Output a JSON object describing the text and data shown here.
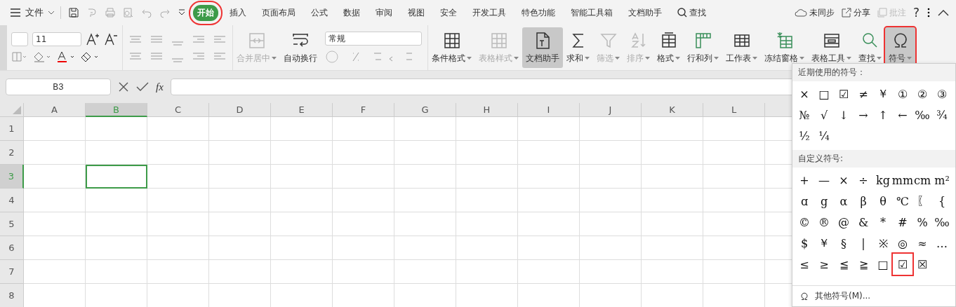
{
  "menu_bar": {
    "file_menu": "文件",
    "tabs": [
      {
        "label": "开始",
        "selected": true,
        "highlighted": true
      },
      {
        "label": "插入",
        "selected": false,
        "highlighted": false
      },
      {
        "label": "页面布局",
        "selected": false,
        "highlighted": false
      },
      {
        "label": "公式",
        "selected": false,
        "highlighted": false
      },
      {
        "label": "数据",
        "selected": false,
        "highlighted": false
      },
      {
        "label": "审阅",
        "selected": false,
        "highlighted": false
      },
      {
        "label": "视图",
        "selected": false,
        "highlighted": false
      },
      {
        "label": "安全",
        "selected": false,
        "highlighted": false
      },
      {
        "label": "开发工具",
        "selected": false,
        "highlighted": false
      },
      {
        "label": "特色功能",
        "selected": false,
        "highlighted": false
      },
      {
        "label": "智能工具箱",
        "selected": false,
        "highlighted": false
      },
      {
        "label": "文档助手",
        "selected": false,
        "highlighted": false
      }
    ],
    "search": "查找",
    "sync": "未同步",
    "share": "分享",
    "comment": {
      "label": "批注",
      "disabled": true
    },
    "help": "?"
  },
  "ribbon": {
    "font_size": "11",
    "number_format": "常规",
    "buttons": [
      {
        "kind": "merge",
        "label": "合并居中",
        "disabled": true,
        "selected": false,
        "caret": true,
        "highlighted": false
      },
      {
        "kind": "wrap",
        "label": "自动换行",
        "disabled": false,
        "selected": false,
        "caret": false,
        "highlighted": false
      },
      {
        "kind": "cond",
        "label": "条件格式",
        "disabled": false,
        "selected": false,
        "caret": true,
        "highlighted": false
      },
      {
        "kind": "style",
        "label": "表格样式",
        "disabled": true,
        "selected": false,
        "caret": true,
        "highlighted": false
      },
      {
        "kind": "doc",
        "label": "文档助手",
        "disabled": false,
        "selected": true,
        "caret": false,
        "highlighted": false
      },
      {
        "kind": "sum",
        "label": "求和",
        "disabled": false,
        "selected": false,
        "caret": true,
        "highlighted": false
      },
      {
        "kind": "filter",
        "label": "筛选",
        "disabled": true,
        "selected": false,
        "caret": true,
        "highlighted": false
      },
      {
        "kind": "sort",
        "label": "排序",
        "disabled": true,
        "selected": false,
        "caret": true,
        "highlighted": false
      },
      {
        "kind": "format",
        "label": "格式",
        "disabled": false,
        "selected": false,
        "caret": true,
        "highlighted": false
      },
      {
        "kind": "rowcol",
        "label": "行和列",
        "disabled": false,
        "selected": false,
        "caret": true,
        "highlighted": false
      },
      {
        "kind": "sheet",
        "label": "工作表",
        "disabled": false,
        "selected": false,
        "caret": true,
        "highlighted": false
      },
      {
        "kind": "freeze",
        "label": "冻结窗格",
        "disabled": false,
        "selected": false,
        "caret": true,
        "highlighted": false
      },
      {
        "kind": "tools",
        "label": "表格工具",
        "disabled": false,
        "selected": false,
        "caret": true,
        "highlighted": false
      },
      {
        "kind": "find",
        "label": "查找",
        "disabled": false,
        "selected": false,
        "caret": true,
        "highlighted": false
      },
      {
        "kind": "omega",
        "label": "符号",
        "disabled": false,
        "selected": true,
        "caret": true,
        "highlighted": true
      }
    ]
  },
  "formula_bar": {
    "name_box": "B3",
    "fx": "fx"
  },
  "sheet": {
    "columns": [
      {
        "label": "A",
        "selected": false
      },
      {
        "label": "B",
        "selected": true
      },
      {
        "label": "C",
        "selected": false
      },
      {
        "label": "D",
        "selected": false
      },
      {
        "label": "E",
        "selected": false
      },
      {
        "label": "F",
        "selected": false
      },
      {
        "label": "G",
        "selected": false
      },
      {
        "label": "H",
        "selected": false
      },
      {
        "label": "I",
        "selected": false
      },
      {
        "label": "J",
        "selected": false
      },
      {
        "label": "K",
        "selected": false
      },
      {
        "label": "L",
        "selected": false
      }
    ],
    "rows": [
      {
        "label": "1",
        "selected": false
      },
      {
        "label": "2",
        "selected": false
      },
      {
        "label": "3",
        "selected": true
      },
      {
        "label": "4",
        "selected": false
      },
      {
        "label": "5",
        "selected": false
      },
      {
        "label": "6",
        "selected": false
      },
      {
        "label": "7",
        "selected": false
      },
      {
        "label": "8",
        "selected": false
      }
    ]
  },
  "symbol_menu": {
    "recent_title": "近期使用的符号：",
    "recent": [
      {
        "symbol": "×",
        "highlighted": false
      },
      {
        "symbol": "□",
        "highlighted": false
      },
      {
        "symbol": "☑",
        "highlighted": false
      },
      {
        "symbol": "≠",
        "highlighted": false
      },
      {
        "symbol": "￥",
        "highlighted": false
      },
      {
        "symbol": "①",
        "highlighted": false
      },
      {
        "symbol": "②",
        "highlighted": false
      },
      {
        "symbol": "③",
        "highlighted": false
      },
      {
        "symbol": "№",
        "highlighted": false
      },
      {
        "symbol": "√",
        "highlighted": false
      },
      {
        "symbol": "↓",
        "highlighted": false
      },
      {
        "symbol": "→",
        "highlighted": false
      },
      {
        "symbol": "↑",
        "highlighted": false
      },
      {
        "symbol": "←",
        "highlighted": false
      },
      {
        "symbol": "‰",
        "highlighted": false
      },
      {
        "symbol": "¾",
        "highlighted": false
      },
      {
        "symbol": "½",
        "highlighted": false
      },
      {
        "symbol": "¼",
        "highlighted": false
      }
    ],
    "custom_title": "自定义符号:",
    "custom": [
      {
        "symbol": "+",
        "highlighted": false
      },
      {
        "symbol": "—",
        "highlighted": false
      },
      {
        "symbol": "×",
        "highlighted": false
      },
      {
        "symbol": "÷",
        "highlighted": false
      },
      {
        "symbol": "kg",
        "highlighted": false
      },
      {
        "symbol": "mm",
        "highlighted": false
      },
      {
        "symbol": "cm",
        "highlighted": false
      },
      {
        "symbol": "m²",
        "highlighted": false
      },
      {
        "symbol": "ɑ",
        "highlighted": false
      },
      {
        "symbol": "g",
        "highlighted": false
      },
      {
        "symbol": "α",
        "highlighted": false
      },
      {
        "symbol": "β",
        "highlighted": false
      },
      {
        "symbol": "θ",
        "highlighted": false
      },
      {
        "symbol": "℃",
        "highlighted": false
      },
      {
        "symbol": "〖",
        "highlighted": false
      },
      {
        "symbol": "{",
        "highlighted": false
      },
      {
        "symbol": "©",
        "highlighted": false
      },
      {
        "symbol": "®",
        "highlighted": false
      },
      {
        "symbol": "@",
        "highlighted": false
      },
      {
        "symbol": "&",
        "highlighted": false
      },
      {
        "symbol": "*",
        "highlighted": false
      },
      {
        "symbol": "#",
        "highlighted": false
      },
      {
        "symbol": "%",
        "highlighted": false
      },
      {
        "symbol": "‰",
        "highlighted": false
      },
      {
        "symbol": "$",
        "highlighted": false
      },
      {
        "symbol": "￥",
        "highlighted": false
      },
      {
        "symbol": "§",
        "highlighted": false
      },
      {
        "symbol": "|",
        "highlighted": false
      },
      {
        "symbol": "※",
        "highlighted": false
      },
      {
        "symbol": "◎",
        "highlighted": false
      },
      {
        "symbol": "≈",
        "highlighted": false
      },
      {
        "symbol": "…",
        "highlighted": false
      },
      {
        "symbol": "≤",
        "highlighted": false
      },
      {
        "symbol": "≥",
        "highlighted": false
      },
      {
        "symbol": "≦",
        "highlighted": false
      },
      {
        "symbol": "≧",
        "highlighted": false
      },
      {
        "symbol": "□",
        "highlighted": false
      },
      {
        "symbol": "☑",
        "highlighted": true
      },
      {
        "symbol": "☒",
        "highlighted": false
      }
    ],
    "more": "其他符号(M)..."
  }
}
